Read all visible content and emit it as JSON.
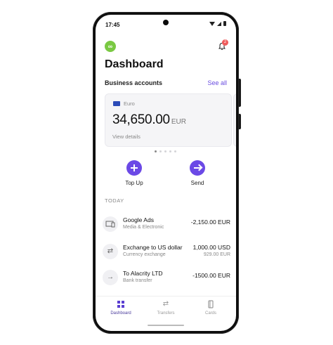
{
  "status_bar": {
    "time": "17:45"
  },
  "header": {
    "logo_text": "∞",
    "notification_count": "2",
    "title": "Dashboard"
  },
  "accounts": {
    "section_title": "Business accounts",
    "see_all": "See all",
    "card": {
      "currency_name": "Euro",
      "balance": "34,650.00",
      "balance_currency": "EUR",
      "view_details": "View details"
    },
    "carousel": {
      "page_count": 5,
      "active_index": 0
    }
  },
  "actions": [
    {
      "label": "Top Up",
      "icon": "plus-icon"
    },
    {
      "label": "Send",
      "icon": "arrow-right-icon"
    }
  ],
  "transactions": {
    "section_label": "TODAY",
    "items": [
      {
        "name": "Google Ads",
        "subtitle": "Media & Electronic",
        "amount": "-2,150.00 EUR",
        "icon": "device-icon"
      },
      {
        "name": "Exchange to US dollar",
        "subtitle": "Currency exchange",
        "amount": "1,000.00 USD",
        "secondary_amount": "929.00 EUR",
        "icon": "exchange-icon"
      },
      {
        "name": "To Alacrity LTD",
        "subtitle": "Bank transfer",
        "amount": "-1500.00 EUR",
        "icon": "arrow-right-icon"
      }
    ]
  },
  "tabbar": {
    "tabs": [
      {
        "label": "Dashboard",
        "icon": "grid-icon",
        "active": true
      },
      {
        "label": "Transfers",
        "icon": "transfer-icon",
        "active": false
      },
      {
        "label": "Cards",
        "icon": "card-icon",
        "active": false
      }
    ]
  },
  "colors": {
    "accent": "#6b49e6",
    "logo": "#7ac943",
    "badge": "#ef5b5b"
  }
}
